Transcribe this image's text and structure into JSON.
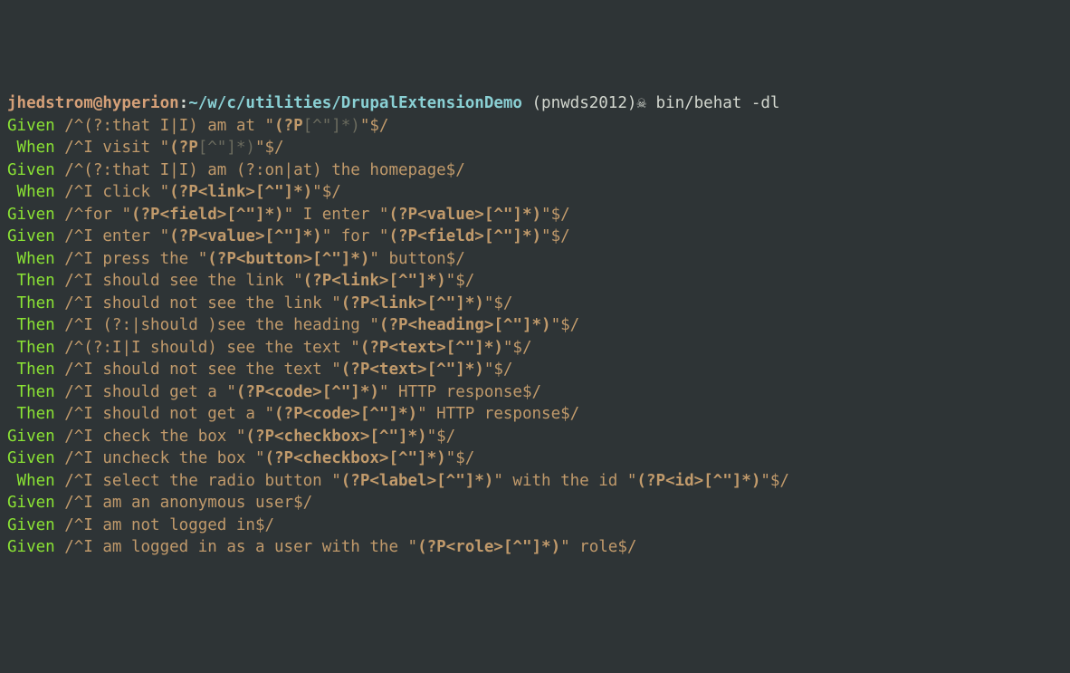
{
  "prompt": {
    "user": "jhedstrom@hyperion",
    "sep1": ":",
    "path": "~/w/c/utilities/DrupalExtensionDemo",
    "space": " ",
    "branch": "(pnwds2012)",
    "symbol": "☠",
    "command": " bin/behat -dl"
  },
  "lines": [
    {
      "kw": "Given",
      "segs": [
        {
          "t": " /^(?:that I|I) am at \"",
          "c": "rx"
        },
        {
          "t": "(?P",
          "c": "rx bold-rx"
        },
        {
          "t": "[^\"]*)",
          "c": "dim-rx"
        },
        {
          "t": "\"$/",
          "c": "rx"
        }
      ]
    },
    {
      "kw": " When",
      "segs": [
        {
          "t": " /^I visit \"",
          "c": "rx"
        },
        {
          "t": "(?P",
          "c": "rx bold-rx"
        },
        {
          "t": "[^\"]*)",
          "c": "dim-rx"
        },
        {
          "t": "\"$/",
          "c": "rx"
        }
      ]
    },
    {
      "kw": "Given",
      "segs": [
        {
          "t": " /^(?:that I|I) am (?:on|at) the homepage$/",
          "c": "rx"
        }
      ]
    },
    {
      "kw": " When",
      "segs": [
        {
          "t": " /^I click \"",
          "c": "rx"
        },
        {
          "t": "(?P<link>[^\"]*)",
          "c": "rx bold-rx"
        },
        {
          "t": "\"$/",
          "c": "rx"
        }
      ]
    },
    {
      "kw": "Given",
      "segs": [
        {
          "t": " /^for \"",
          "c": "rx"
        },
        {
          "t": "(?P<field>[^\"]*)",
          "c": "rx bold-rx"
        },
        {
          "t": "\" I enter \"",
          "c": "rx"
        },
        {
          "t": "(?P<value>[^\"]*)",
          "c": "rx bold-rx"
        },
        {
          "t": "\"$/",
          "c": "rx"
        }
      ]
    },
    {
      "kw": "Given",
      "segs": [
        {
          "t": " /^I enter \"",
          "c": "rx"
        },
        {
          "t": "(?P<value>[^\"]*)",
          "c": "rx bold-rx"
        },
        {
          "t": "\" for \"",
          "c": "rx"
        },
        {
          "t": "(?P<field>[^\"]*)",
          "c": "rx bold-rx"
        },
        {
          "t": "\"$/",
          "c": "rx"
        }
      ]
    },
    {
      "kw": " When",
      "segs": [
        {
          "t": " /^I press the \"",
          "c": "rx"
        },
        {
          "t": "(?P<button>[^\"]*)",
          "c": "rx bold-rx"
        },
        {
          "t": "\" button$/",
          "c": "rx"
        }
      ]
    },
    {
      "kw": " Then",
      "segs": [
        {
          "t": " /^I should see the link \"",
          "c": "rx"
        },
        {
          "t": "(?P<link>[^\"]*)",
          "c": "rx bold-rx"
        },
        {
          "t": "\"$/",
          "c": "rx"
        }
      ]
    },
    {
      "kw": " Then",
      "segs": [
        {
          "t": " /^I should not see the link \"",
          "c": "rx"
        },
        {
          "t": "(?P<link>[^\"]*)",
          "c": "rx bold-rx"
        },
        {
          "t": "\"$/",
          "c": "rx"
        }
      ]
    },
    {
      "kw": " Then",
      "segs": [
        {
          "t": " /^I (?:|should )see the heading \"",
          "c": "rx"
        },
        {
          "t": "(?P<heading>[^\"]*)",
          "c": "rx bold-rx"
        },
        {
          "t": "\"$/",
          "c": "rx"
        }
      ]
    },
    {
      "kw": " Then",
      "segs": [
        {
          "t": " /^(?:I|I should) see the text \"",
          "c": "rx"
        },
        {
          "t": "(?P<text>[^\"]*)",
          "c": "rx bold-rx"
        },
        {
          "t": "\"$/",
          "c": "rx"
        }
      ]
    },
    {
      "kw": " Then",
      "segs": [
        {
          "t": " /^I should not see the text \"",
          "c": "rx"
        },
        {
          "t": "(?P<text>[^\"]*)",
          "c": "rx bold-rx"
        },
        {
          "t": "\"$/",
          "c": "rx"
        }
      ]
    },
    {
      "kw": " Then",
      "segs": [
        {
          "t": " /^I should get a \"",
          "c": "rx"
        },
        {
          "t": "(?P<code>[^\"]*)",
          "c": "rx bold-rx"
        },
        {
          "t": "\" HTTP response$/",
          "c": "rx"
        }
      ]
    },
    {
      "kw": " Then",
      "segs": [
        {
          "t": " /^I should not get a \"",
          "c": "rx"
        },
        {
          "t": "(?P<code>[^\"]*)",
          "c": "rx bold-rx"
        },
        {
          "t": "\" HTTP response$/",
          "c": "rx"
        }
      ]
    },
    {
      "kw": "Given",
      "segs": [
        {
          "t": " /^I check the box \"",
          "c": "rx"
        },
        {
          "t": "(?P<checkbox>[^\"]*)",
          "c": "rx bold-rx"
        },
        {
          "t": "\"$/",
          "c": "rx"
        }
      ]
    },
    {
      "kw": "Given",
      "segs": [
        {
          "t": " /^I uncheck the box \"",
          "c": "rx"
        },
        {
          "t": "(?P<checkbox>[^\"]*)",
          "c": "rx bold-rx"
        },
        {
          "t": "\"$/",
          "c": "rx"
        }
      ]
    },
    {
      "kw": " When",
      "segs": [
        {
          "t": " /^I select the radio button \"",
          "c": "rx"
        },
        {
          "t": "(?P<label>[^\"]*)",
          "c": "rx bold-rx"
        },
        {
          "t": "\" with the id \"",
          "c": "rx"
        },
        {
          "t": "(?P<id>[^\"]*)",
          "c": "rx bold-rx"
        },
        {
          "t": "\"$/",
          "c": "rx"
        }
      ]
    },
    {
      "kw": "Given",
      "segs": [
        {
          "t": " /^I am an anonymous user$/",
          "c": "rx"
        }
      ]
    },
    {
      "kw": "Given",
      "segs": [
        {
          "t": " /^I am not logged in$/",
          "c": "rx"
        }
      ]
    },
    {
      "kw": "Given",
      "segs": [
        {
          "t": " /^I am logged in as a user with the \"",
          "c": "rx"
        },
        {
          "t": "(?P<role>[^\"]*)",
          "c": "rx bold-rx"
        },
        {
          "t": "\" role$/",
          "c": "rx"
        }
      ]
    }
  ]
}
